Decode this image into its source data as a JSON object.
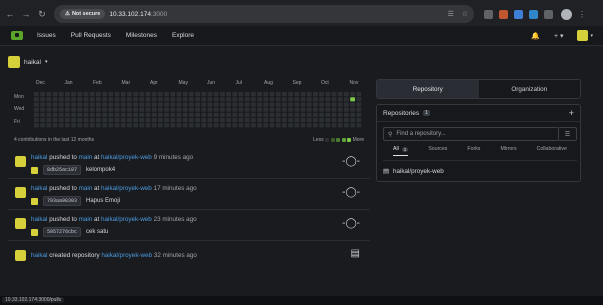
{
  "browser": {
    "not_secure": "Not secure",
    "url_host": "10.33.102.174",
    "url_rest": ":3000"
  },
  "nav": {
    "issues": "Issues",
    "pulls": "Pull Requests",
    "milestones": "Milestones",
    "explore": "Explore"
  },
  "context": {
    "user": "haikal"
  },
  "heatmap": {
    "months": [
      "Dec",
      "Jan",
      "Feb",
      "Mar",
      "Apr",
      "May",
      "Jun",
      "Jul",
      "Aug",
      "Sep",
      "Oct",
      "Nov"
    ],
    "days": [
      "Mon",
      "Wed",
      "Fri"
    ],
    "summary": "4 contributions in the last 12 months",
    "less": "Less",
    "more": "More",
    "active_week": 51,
    "active_day": 1,
    "empty_color": "#2b2e33",
    "legend_colors": [
      "#2b2e33",
      "#3d5a2a",
      "#4d7a32",
      "#5fa03a",
      "#7cc84a"
    ]
  },
  "feed": [
    {
      "user": "haikal",
      "action": "pushed to",
      "branch": "main",
      "at": "at",
      "repo": "haikal/proyek-web",
      "time": "9 minutes ago",
      "sha": "8db25ac187",
      "message": "kelompok4"
    },
    {
      "user": "haikal",
      "action": "pushed to",
      "branch": "main",
      "at": "at",
      "repo": "haikal/proyek-web",
      "time": "17 minutes ago",
      "sha": "793aa98303",
      "message": "Hapus Emoji"
    },
    {
      "user": "haikal",
      "action": "pushed to",
      "branch": "main",
      "at": "at",
      "repo": "haikal/proyek-web",
      "time": "23 minutes ago",
      "sha": "5957276cbc",
      "message": "cek satu"
    },
    {
      "user": "haikal",
      "action": "created repository",
      "repo": "haikal/proyek-web",
      "time": "32 minutes ago"
    }
  ],
  "sidebar": {
    "tab_repository": "Repository",
    "tab_organization": "Organization",
    "repositories": "Repositories",
    "repo_count": "1",
    "search_placeholder": "Find a repository...",
    "filters": [
      "All",
      "Sources",
      "Forks",
      "Mirrors",
      "Collaborative"
    ],
    "all_count": "1",
    "repo_item": "haikal/proyek-web"
  },
  "status": {
    "link": "10.33.102.174:3000/pulls"
  }
}
